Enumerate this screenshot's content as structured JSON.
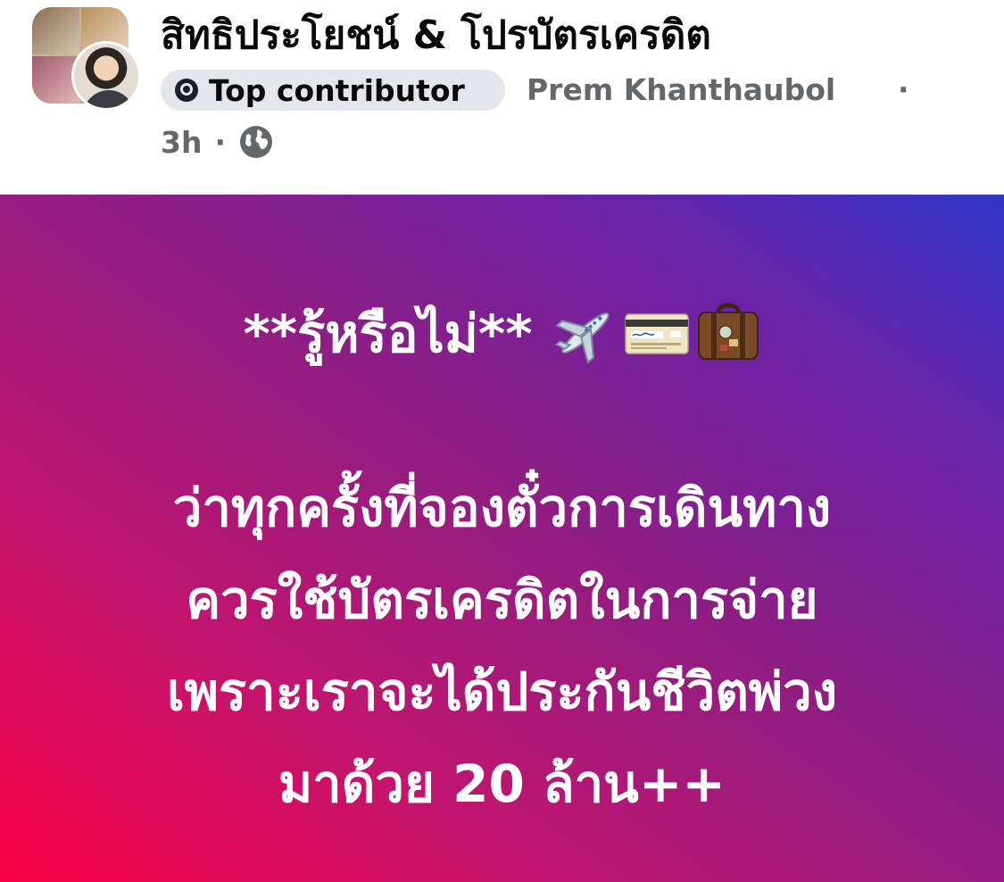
{
  "post": {
    "group_name": "สิทธิประโยชน์ & โปรบัตรเครดิต",
    "badge_label": "Top contributor",
    "author": "Prem Khanthaubol",
    "separator": "·",
    "time": "3h",
    "privacy_icon": "globe-icon"
  },
  "content": {
    "headline": "**รู้หรือไม่**",
    "headline_emojis": [
      "airplane-emoji",
      "credit-card-emoji",
      "luggage-emoji"
    ],
    "lines": [
      "ว่าทุกครั้งที่จองตั๋วการเดินทาง",
      "ควรใช้บัตรเครดิตในการจ่าย",
      "เพราะเราจะได้ประกันชีวิตพ่วง",
      "มาด้วย 20 ล้าน++"
    ],
    "background_colors": [
      "#fb0246",
      "#8e1e83",
      "#2f35c9"
    ]
  }
}
